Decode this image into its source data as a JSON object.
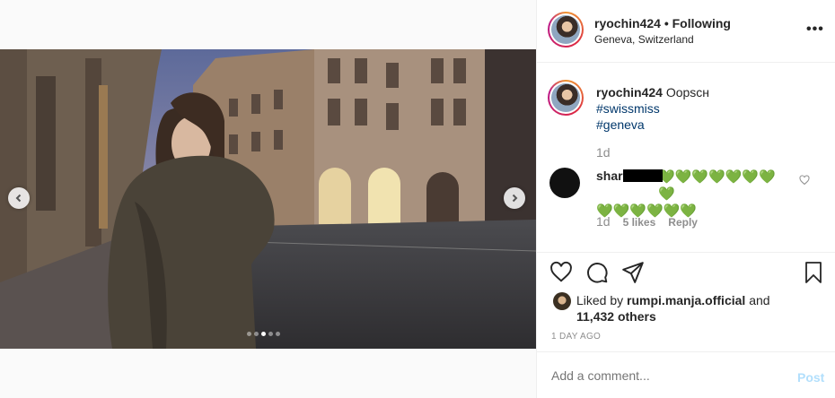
{
  "post": {
    "username": "ryochin424",
    "separator": "•",
    "follow_status": "Following",
    "location": "Geneva, Switzerland",
    "more_icon": "more-options-icon"
  },
  "caption": {
    "username": "ryochin424",
    "text": "Oopsсн",
    "hashtags": [
      "#swissmiss",
      "#geneva"
    ],
    "time": "1d"
  },
  "comment": {
    "username_visible": "shar",
    "hearts_row1": "💚💚💚💚💚💚💚💚",
    "hearts_row2": "💚💚💚💚💚💚",
    "time": "1d",
    "likes": "5 likes",
    "reply": "Reply"
  },
  "likes": {
    "prefix": "Liked by",
    "user": "rumpi.manja.official",
    "and": "and",
    "others": "11,432 others"
  },
  "timestamp": "1 DAY AGO",
  "add_comment": {
    "placeholder": "Add a comment...",
    "post_label": "Post"
  },
  "carousel": {
    "count": 5,
    "active_index": 2
  },
  "colors": {
    "link": "#00376b",
    "muted": "#8e8e8e",
    "post_disabled": "#b2dffc",
    "heart_green": "#22b622"
  }
}
